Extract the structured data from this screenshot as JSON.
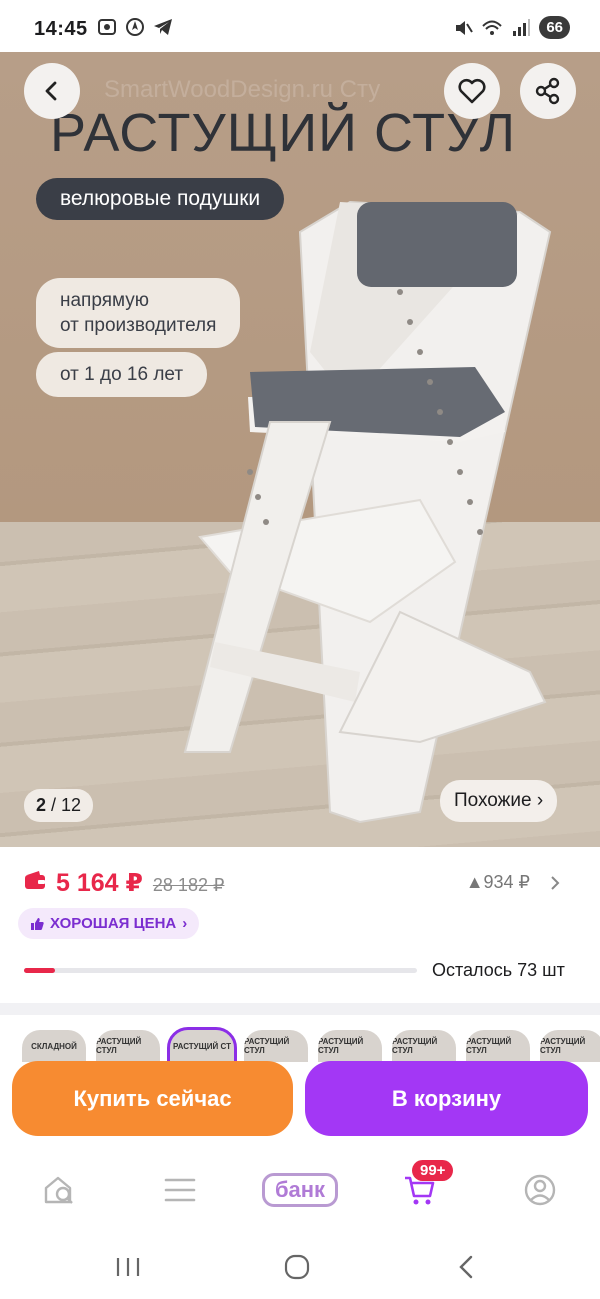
{
  "status_bar": {
    "time": "14:45",
    "battery": "66"
  },
  "hero": {
    "watermark": "SmartWoodDesign.ru Сту",
    "title": "РАСТУЩИЙ СТУЛ",
    "tag_dark": "велюровые подушки",
    "tag_light_1": "напрямую\nот производителя",
    "tag_light_1_line1": "напрямую",
    "tag_light_1_line2": "от производителя",
    "tag_light_2": "от 1 до 16 лет",
    "counter_current": "2",
    "counter_total": "/ 12",
    "similar_label": "Похожие ›",
    "icons": {
      "back": "chevron-left-icon",
      "favorite": "heart-icon",
      "share": "share-icon"
    }
  },
  "price": {
    "current": "5 164 ₽",
    "old": "28 182 ₽",
    "bonus": "▲934 ₽",
    "good_price_label": "ХОРОШАЯ ЦЕНА",
    "stock_text": "Осталось 73 шт",
    "stock_progress_fraction": 0.08
  },
  "thumbnails": [
    {
      "label": "СКЛАДНОЙ"
    },
    {
      "label": "РАСТУЩИЙ СТУЛ"
    },
    {
      "label": "РАСТУЩИЙ СТ"
    },
    {
      "label": "РАСТУЩИЙ СТУЛ"
    },
    {
      "label": "РАСТУЩИЙ СТУЛ"
    },
    {
      "label": "РАСТУЩИЙ СТУЛ"
    },
    {
      "label": "РАСТУЩИЙ СТУЛ"
    },
    {
      "label": "РАСТУЩИЙ СТУЛ"
    }
  ],
  "actions": {
    "buy_now": "Купить сейчас",
    "add_to_cart": "В корзину"
  },
  "tabbar": {
    "bank_label": "банк",
    "cart_badge": "99+"
  },
  "colors": {
    "accent_red": "#e8274a",
    "buy_orange": "#f78b31",
    "cart_purple": "#a337f5"
  }
}
